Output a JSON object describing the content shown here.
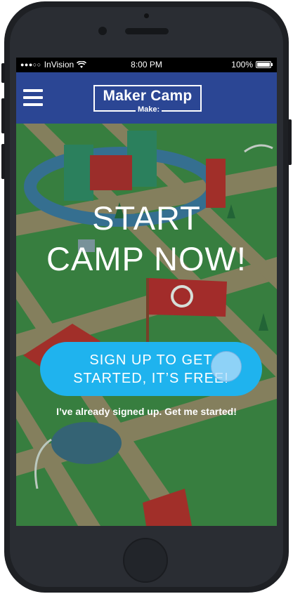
{
  "status_bar": {
    "signal": "●●●○○",
    "carrier": "InVision",
    "time": "8:00 PM",
    "battery": "100%"
  },
  "header": {
    "logo_title": "Maker Camp",
    "logo_subtitle": "Make:"
  },
  "hero": {
    "headline_line1": "START",
    "headline_line2": "CAMP NOW!"
  },
  "cta": {
    "line1": "SIGN UP TO GET",
    "line2": "STARTED, IT’S FREE!"
  },
  "secondary_link": "I’ve already signed up. Get me started!",
  "colors": {
    "nav_blue": "#2b4694",
    "cta_blue": "#1fb3ee",
    "grass_green": "#3f8a46"
  }
}
